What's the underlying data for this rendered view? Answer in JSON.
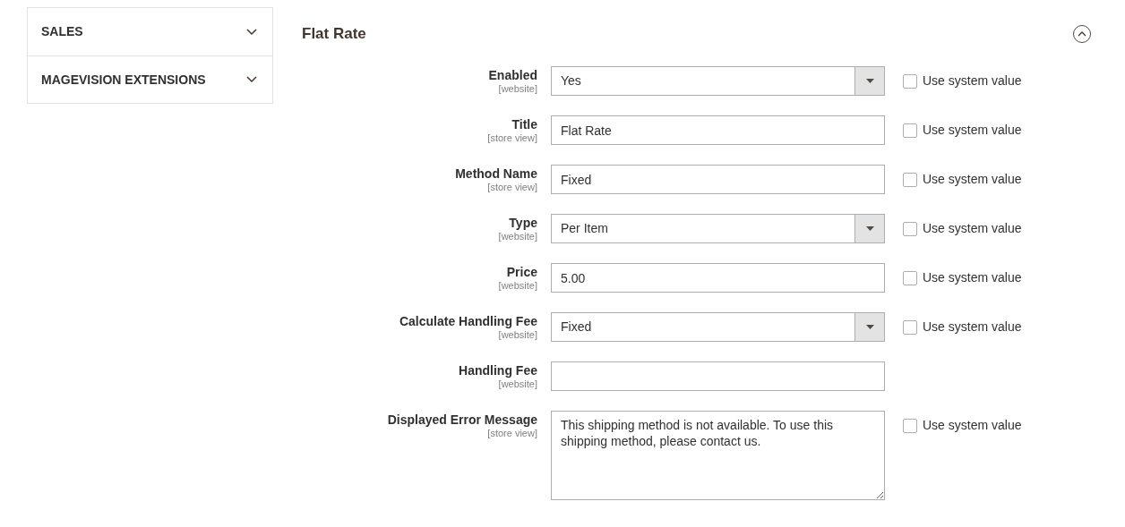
{
  "sidebar": {
    "items": [
      {
        "label": "SALES",
        "expanded": false
      },
      {
        "label": "MAGEVISION EXTENSIONS",
        "expanded": false
      }
    ]
  },
  "section": {
    "title": "Flat Rate",
    "expanded": true,
    "fields": [
      {
        "kind": "select",
        "label": "Enabled",
        "scope": "[website]",
        "value": "Yes",
        "use_system_value": {
          "label": "Use system value",
          "checked": false
        }
      },
      {
        "kind": "text",
        "label": "Title",
        "scope": "[store view]",
        "value": "Flat Rate",
        "use_system_value": {
          "label": "Use system value",
          "checked": false
        }
      },
      {
        "kind": "text",
        "label": "Method Name",
        "scope": "[store view]",
        "value": "Fixed",
        "use_system_value": {
          "label": "Use system value",
          "checked": false
        }
      },
      {
        "kind": "select",
        "label": "Type",
        "scope": "[website]",
        "value": "Per Item",
        "use_system_value": {
          "label": "Use system value",
          "checked": false
        }
      },
      {
        "kind": "text",
        "label": "Price",
        "scope": "[website]",
        "value": "5.00",
        "use_system_value": {
          "label": "Use system value",
          "checked": false
        }
      },
      {
        "kind": "select",
        "label": "Calculate Handling Fee",
        "scope": "[website]",
        "value": "Fixed",
        "use_system_value": {
          "label": "Use system value",
          "checked": false
        }
      },
      {
        "kind": "text",
        "label": "Handling Fee",
        "scope": "[website]"
      },
      {
        "kind": "textarea",
        "label": "Displayed Error Message",
        "scope": "[store view]",
        "value": "This shipping method is not available. To use this shipping method, please contact us.",
        "use_system_value": {
          "label": "Use system value",
          "checked": false
        }
      }
    ]
  }
}
